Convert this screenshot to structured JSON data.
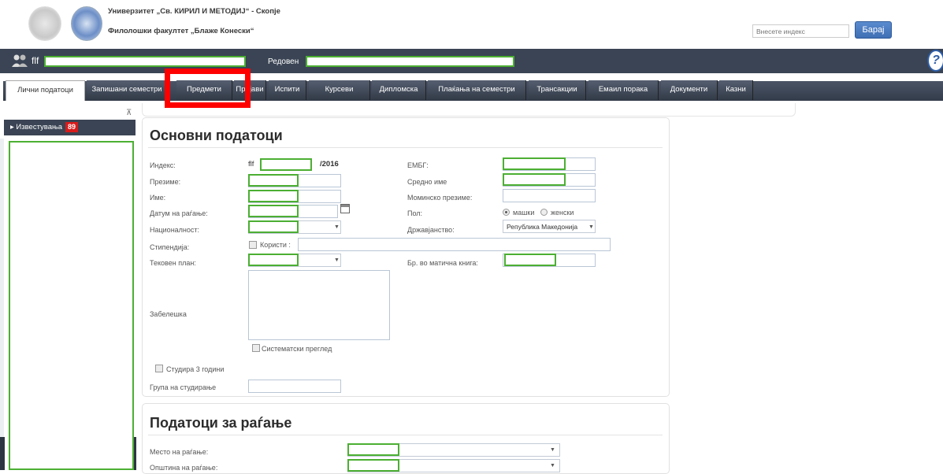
{
  "header": {
    "university": "Универзитет „Св. КИРИЛ И МЕТОДИЈ“ - Скопје",
    "faculty": "Филолошки факултет „Блаже Конески“",
    "search_placeholder": "Внесете индекс",
    "search_button": "Барај"
  },
  "userbar": {
    "prefix": "flf",
    "status_label": "Редовен",
    "help_label": "?"
  },
  "tabs": [
    {
      "label": "Лични податоци",
      "active": true
    },
    {
      "label": "Запишани семестри"
    },
    {
      "label": "Предмети"
    },
    {
      "label": "Пријави"
    },
    {
      "label": "Испити"
    },
    {
      "label": "Курсеви"
    },
    {
      "label": "Дипломска"
    },
    {
      "label": "Плаќања на семестри"
    },
    {
      "label": "Трансакции"
    },
    {
      "label": "Емаил порака"
    },
    {
      "label": "Документи"
    },
    {
      "label": "Казни"
    }
  ],
  "sidebar": {
    "pin": "⊼",
    "header": "▸ Известувања",
    "badge": "89"
  },
  "basic": {
    "title": "Основни податоци",
    "index_label": "Индекс:",
    "index_prefix": "flf",
    "index_year": "/2016",
    "surname_label": "Презиме:",
    "name_label": "Име:",
    "birthdate_label": "Датум на раѓање:",
    "nationality_label": "Националност:",
    "scholarship_label": "Стипендија:",
    "scholarship_checkbox": "Користи :",
    "curriculum_label": "Тековен план:",
    "note_label": "Забелешка",
    "systematic_label": "Систематски преглед",
    "three_years_label": "Студира 3 години",
    "group_label": "Група на студирање",
    "embg_label": "ЕМБГ:",
    "middle_name_label": "Средно име",
    "maiden_label": "Моминско презиме:",
    "gender_label": "Пол:",
    "gender_male": "машки",
    "gender_female": "женски",
    "citizenship_label": "Државјанство:",
    "citizenship_value": "Република Македонија",
    "book_label": "Бр. во матична книга:"
  },
  "birth": {
    "title": "Податоци за раѓање",
    "place_label": "Место на раѓање:",
    "municipality_label": "Општина на раѓање:"
  }
}
